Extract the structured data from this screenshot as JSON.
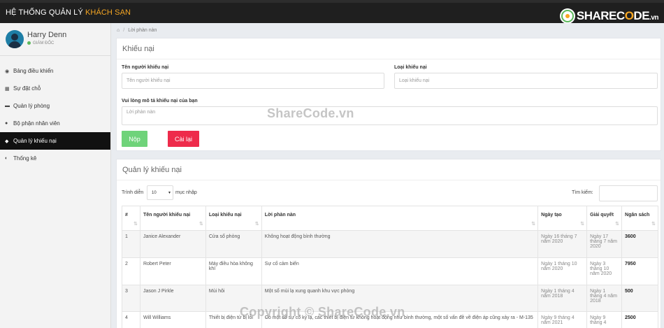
{
  "app": {
    "title_main": "HỆ THỐNG QUẢN LÝ",
    "title_highlight": "KHÁCH SẠN",
    "logo_text_pre": "SHAREC",
    "logo_text_o": "O",
    "logo_text_post": "DE",
    "logo_text_vn": ".vn"
  },
  "user": {
    "name": "Harry Denn",
    "role": "GIÁM ĐỐC"
  },
  "nav": [
    {
      "label": "Bảng điều khiển",
      "icon": "dashboard-icon",
      "glyph": "◉"
    },
    {
      "label": "Sự đặt chỗ",
      "icon": "calendar-icon",
      "glyph": "▦"
    },
    {
      "label": "Quản lý phòng",
      "icon": "bed-icon",
      "glyph": "▬"
    },
    {
      "label": "Bộ phận nhân viên",
      "icon": "users-icon",
      "glyph": "●"
    },
    {
      "label": "Quản lý khiếu nại",
      "icon": "comment-icon",
      "glyph": "◆"
    },
    {
      "label": "Thống kê",
      "icon": "pie-chart-icon",
      "glyph": "◐"
    }
  ],
  "breadcrumb": {
    "home_icon": "⌂",
    "separator": "/",
    "current": "Lời phàn nàn"
  },
  "form": {
    "title": "Khiếu nại",
    "name_label": "Tên người khiếu nại",
    "name_placeholder": "Tên người khiếu nại",
    "type_label": "Loại khiếu nại",
    "type_placeholder": "Loại khiếu nại",
    "desc_label": "Vui lòng mô tả khiếu nại của bạn",
    "desc_placeholder": "Lời phàn nàn",
    "submit": "Nộp",
    "reset": "Cài lại"
  },
  "list": {
    "title": "Quản lý khiếu nại",
    "show_label": "Trình diễn",
    "page_size": "10",
    "entries_label": "mục nhập",
    "search_label": "Tìm kiếm:",
    "columns": [
      "#",
      "Tên người khiếu nại",
      "Loại khiếu nại",
      "Lời phàn nàn",
      "Ngày tạo",
      "Giải quyết",
      "Ngân sách"
    ],
    "rows": [
      [
        "1",
        "Janice Alexander",
        "Cửa sổ phòng",
        "Không hoạt động bình thường",
        "Ngày 16 tháng 7 năm 2020",
        "Ngày 17 tháng 7 năm 2020",
        "3600"
      ],
      [
        "2",
        "Robert Peter",
        "Máy điều hòa không khí",
        "Sự cố cảm biến",
        "Ngày 1 tháng 10 năm 2020",
        "Ngày 3 tháng 10 năm 2020",
        "7950"
      ],
      [
        "3",
        "Jason J Pirkle",
        "Mùi hôi",
        "Một số mùi lạ xung quanh khu vực phòng",
        "Ngày 1 tháng 4 năm 2018",
        "Ngày 1 tháng 4 năm 2018",
        "500"
      ],
      [
        "4",
        "Will Williams",
        "Thiết bị điện tử bị lỗi",
        "Có một số sự cố kỳ lạ, các thiết bị điện tử không hoạt động như bình thường, một số vấn đề về điện áp cũng xảy ra - M-135",
        "Ngày 9 tháng 4 năm 2021",
        "Ngày 9 tháng 4",
        "2500"
      ]
    ]
  },
  "watermarks": {
    "center": "ShareCode.vn",
    "bottom": "Copyright © ShareCode.vn"
  }
}
